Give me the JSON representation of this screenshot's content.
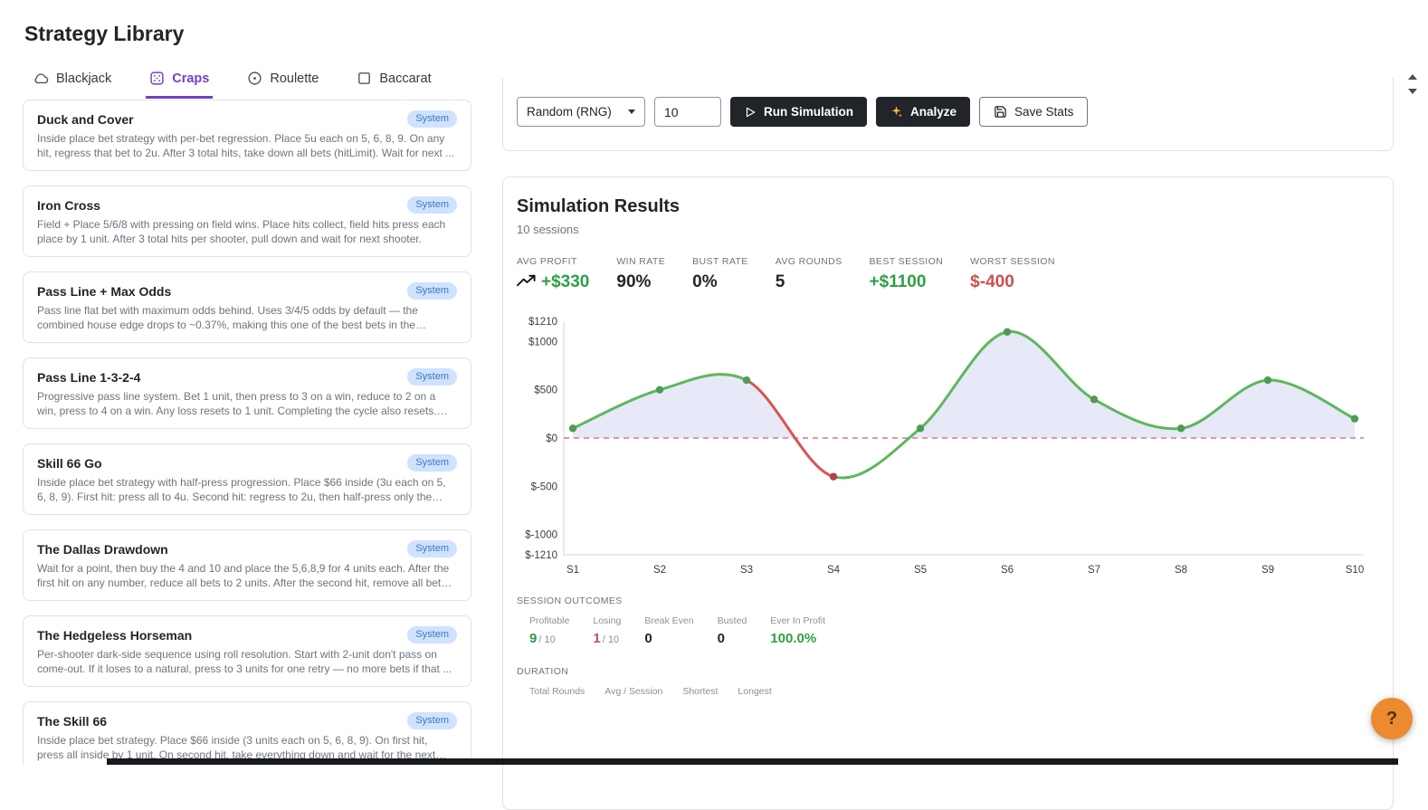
{
  "page": {
    "title": "Strategy Library"
  },
  "theme": {
    "accent_purple": "#6f42c1",
    "green": "#2f9e44",
    "red": "#c9504c",
    "badge_bg": "#cfe2ff",
    "badge_text": "#3a77c2",
    "button_dark": "#212529",
    "help_orange": "#ec8a2f"
  },
  "tabs": [
    {
      "label": "Blackjack",
      "icon": "cloud",
      "active": false
    },
    {
      "label": "Craps",
      "icon": "dice",
      "active": true
    },
    {
      "label": "Roulette",
      "icon": "roulette",
      "active": false
    },
    {
      "label": "Baccarat",
      "icon": "square",
      "active": false
    }
  ],
  "strategies": [
    {
      "title": "Duck and Cover",
      "badge": "System",
      "description": "Inside place bet strategy with per-bet regression. Place 5u each on 5, 6, 8, 9. On any hit, regress that bet to 2u. After 3 total hits, take down all bets (hitLimit). Wait for next ..."
    },
    {
      "title": "Iron Cross",
      "badge": "System",
      "description": "Field + Place 5/6/8 with pressing on field wins. Place hits collect, field hits press each place by 1 unit. After 3 total hits per shooter, pull down and wait for next shooter."
    },
    {
      "title": "Pass Line + Max Odds",
      "badge": "System",
      "description": "Pass line flat bet with maximum odds behind. Uses 3/4/5 odds by default — the combined house edge drops to ~0.37%, making this one of the best bets in the casino...."
    },
    {
      "title": "Pass Line 1-3-2-4",
      "badge": "System",
      "description": "Progressive pass line system. Bet 1 unit, then press to 3 on a win, reduce to 2 on a win, press to 4 on a win. Any loss resets to 1 unit. Completing the cycle also resets. Goal is t..."
    },
    {
      "title": "Skill 66 Go",
      "badge": "System",
      "description": "Inside place bet strategy with half-press progression. Place $66 inside (3u each on 5, 6, 8, 9). First hit: press all to 4u. Second hit: regress to 2u, then half-press only the number ..."
    },
    {
      "title": "The Dallas Drawdown",
      "badge": "System",
      "description": "Wait for a point, then buy the 4 and 10 and place the 5,6,8,9 for 4 units each. After the first hit on any number, reduce all bets to 2 units. After the second hit, remove all bets ..."
    },
    {
      "title": "The Hedgeless Horseman",
      "badge": "System",
      "description": "Per-shooter dark-side sequence using roll resolution. Start with 2-unit don't pass on come-out. If it loses to a natural, press to 3 units for one retry — no more bets if that ..."
    },
    {
      "title": "The Skill 66",
      "badge": "System",
      "description": "Inside place bet strategy. Place $66 inside (3 units each on 5, 6, 8, 9). On first hit, press all inside by 1 unit. On second hit, take everything down and wait for the next shooter."
    }
  ],
  "controls": {
    "roll_source": "Random (RNG)",
    "sessions": "10",
    "run_label": "Run Simulation",
    "analyze_label": "Analyze",
    "save_label": "Save Stats"
  },
  "results": {
    "title": "Simulation Results",
    "subtitle": "10 sessions",
    "stats": [
      {
        "label": "AVG PROFIT",
        "value": "+$330",
        "color": "green",
        "icon": "trending-up"
      },
      {
        "label": "WIN RATE",
        "value": "90%",
        "color": "dark"
      },
      {
        "label": "BUST RATE",
        "value": "0%",
        "color": "dark"
      },
      {
        "label": "AVG ROUNDS",
        "value": "5",
        "color": "dark"
      },
      {
        "label": "BEST SESSION",
        "value": "+$1100",
        "color": "green"
      },
      {
        "label": "WORST SESSION",
        "value": "$-400",
        "color": "red"
      }
    ],
    "outcomes_heading": "SESSION OUTCOMES",
    "outcomes": [
      {
        "label": "Profitable",
        "value": "9",
        "suffix": "/ 10",
        "color": "green"
      },
      {
        "label": "Losing",
        "value": "1",
        "suffix": "/ 10",
        "color": "red"
      },
      {
        "label": "Break Even",
        "value": "0",
        "suffix": "",
        "color": "dark"
      },
      {
        "label": "Busted",
        "value": "0",
        "suffix": "",
        "color": "dark"
      },
      {
        "label": "Ever In Profit",
        "value": "100.0%",
        "suffix": "",
        "color": "green"
      }
    ],
    "duration_heading": "DURATION",
    "duration_labels": [
      "Total Rounds",
      "Avg / Session",
      "Shortest",
      "Longest"
    ]
  },
  "chart_data": {
    "type": "line",
    "x": [
      "S1",
      "S2",
      "S3",
      "S4",
      "S5",
      "S6",
      "S7",
      "S8",
      "S9",
      "S10"
    ],
    "values": [
      100,
      500,
      600,
      -400,
      100,
      1100,
      400,
      100,
      600,
      200
    ],
    "xlabel": "",
    "ylabel": "",
    "ylim": [
      -1210,
      1210
    ],
    "yticks": [
      1210,
      1000,
      500,
      0,
      -500,
      -1000,
      -1210
    ],
    "ytick_labels": [
      "$1210",
      "$1000",
      "$500",
      "$0",
      "$-500",
      "$-1000",
      "$-1210"
    ],
    "zero_line": 0,
    "grid": false,
    "legend": false,
    "colors": {
      "positive": "#5cb85c",
      "negative": "#d9534f",
      "fill": "rgba(105,115,210,0.16)",
      "zero": "#dd7490",
      "marker_positive": "#4e9b52",
      "marker_negative": "#b0435a"
    }
  },
  "help": {
    "label": "?"
  }
}
